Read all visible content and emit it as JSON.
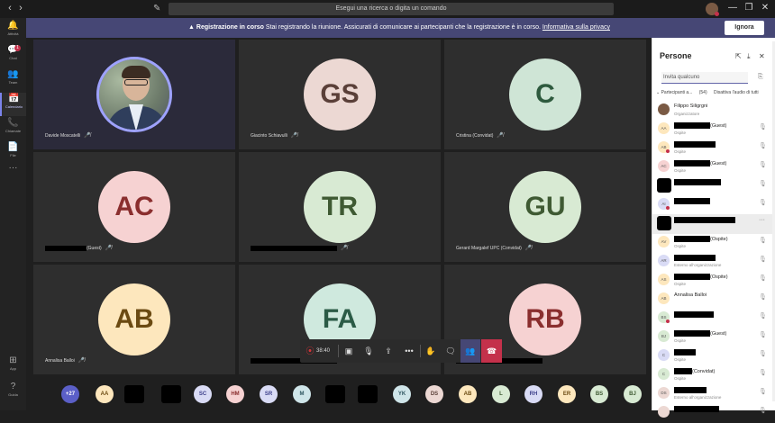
{
  "titlebar": {
    "search_text": "Esegui una ricerca o digita un comando",
    "back": "‹",
    "fwd": "›",
    "edit_icon": "✎",
    "minimize": "—",
    "maximize": "❐",
    "close": "✕"
  },
  "rail": [
    {
      "label": "Attività",
      "icon": "🔔"
    },
    {
      "label": "Chat",
      "icon": "💬",
      "badge": "1"
    },
    {
      "label": "Team",
      "icon": "👥"
    },
    {
      "label": "Calendario",
      "icon": "📅",
      "active": true
    },
    {
      "label": "Chiamate",
      "icon": "📞"
    },
    {
      "label": "File",
      "icon": "📄"
    },
    {
      "label": "",
      "icon": "···"
    },
    {
      "label": "App",
      "icon": "⊞"
    },
    {
      "label": "Guida",
      "icon": "?"
    }
  ],
  "banner": {
    "bold": "Registrazione in corso",
    "text": " Stai registrando la riunione. Assicurati di comunicare ai partecipanti che la registrazione è in corso. ",
    "link": "Informativa sulla privacy",
    "ignore": "Ignora",
    "icon": "▲"
  },
  "tiles": [
    {
      "name": "Davide Moscatelli",
      "initials": "",
      "photo": true
    },
    {
      "name": "Giacinto Schiavulli",
      "initials": "GS",
      "bg": "#ecd8d3",
      "fg": "#5a3f38"
    },
    {
      "name": "Cristina (Convidat)",
      "initials": "C",
      "bg": "#cfe5d6",
      "fg": "#2e5a3e"
    },
    {
      "name": "(Guest)",
      "initials": "AC",
      "bg": "#f6d2d2",
      "fg": "#8a2e2e",
      "redacted": true
    },
    {
      "name": "",
      "initials": "TR",
      "bg": "#d8ead3",
      "fg": "#3f5a33",
      "redacted": true
    },
    {
      "name": "Gerard Margalef UPC (Convidat)",
      "initials": "GU",
      "bg": "#d8ead3",
      "fg": "#3f5a33"
    },
    {
      "name": "Annalisa Balloi",
      "initials": "AB",
      "bg": "#fde7bd",
      "fg": "#6b4a12"
    },
    {
      "name": "",
      "initials": "FA",
      "bg": "#cfe9de",
      "fg": "#2b5b46",
      "redacted": true
    },
    {
      "name": "",
      "initials": "RB",
      "bg": "#f6d2d2",
      "fg": "#8a2e2e",
      "redacted": true
    }
  ],
  "controls": {
    "timer": "38:40",
    "rec": "⦿",
    "camera": "▣",
    "mic": "🎙",
    "share": "⇪",
    "more": "•••",
    "hand": "✋",
    "chat": "🗨",
    "people": "👥",
    "hangup": "☎"
  },
  "strip": [
    {
      "t": "+27",
      "bg": "#5b5fc7",
      "fg": "#fff"
    },
    {
      "t": "AA",
      "bg": "#fde7bd",
      "fg": "#6b4a12"
    },
    {
      "t": "",
      "black": true
    },
    {
      "t": "",
      "black": true
    },
    {
      "t": "SC",
      "bg": "#d9dbf5",
      "fg": "#3d3f8a"
    },
    {
      "t": "HM",
      "bg": "#f6d2d2",
      "fg": "#8a2e2e"
    },
    {
      "t": "SR",
      "bg": "#d9dbf5",
      "fg": "#3d3f8a"
    },
    {
      "t": "M",
      "bg": "#cfe5e9",
      "fg": "#2e5560"
    },
    {
      "t": "",
      "black": true
    },
    {
      "t": "",
      "black": true
    },
    {
      "t": "YK",
      "bg": "#cfe5e9",
      "fg": "#2e5560"
    },
    {
      "t": "DS",
      "bg": "#ecd8d3",
      "fg": "#5a3f38"
    },
    {
      "t": "AB",
      "bg": "#fde7bd",
      "fg": "#6b4a12"
    },
    {
      "t": "L",
      "bg": "#d8ead3",
      "fg": "#3f5a33"
    },
    {
      "t": "RH",
      "bg": "#d9dbf5",
      "fg": "#3d3f8a"
    },
    {
      "t": "ER",
      "bg": "#fde7bd",
      "fg": "#6b4a12"
    },
    {
      "t": "BS",
      "bg": "#d8ead3",
      "fg": "#3f5a33"
    },
    {
      "t": "BJ",
      "bg": "#d8ead3",
      "fg": "#3f5a33"
    }
  ],
  "panel": {
    "title": "Persone",
    "invite_placeholder": "Invita qualcuno",
    "section_label": "Partecipanti a...",
    "count": "(54)",
    "mute_all": "Disattiva l'audio di tutti",
    "rows": [
      {
        "name": "Filippo Siligrgni",
        "sub": "Organizzatore",
        "initials": "",
        "photo": true,
        "bg": "#7a5a44"
      },
      {
        "name": "(Guest)",
        "sub": "Ospite",
        "initials": "AA",
        "bg": "#fde7bd",
        "redact_w": 40
      },
      {
        "name": "",
        "sub": "Ospite",
        "initials": "AB",
        "bg": "#fde7bd",
        "dot": true,
        "redact_w": 46
      },
      {
        "name": "(Guest)",
        "sub": "Ospite",
        "initials": "AC",
        "bg": "#f6d2d2",
        "redact_w": 40
      },
      {
        "name": "",
        "sub": "",
        "initials": "",
        "black": true,
        "redact_w": 52
      },
      {
        "name": "",
        "sub": "",
        "initials": "AI",
        "bg": "#d9dbf5",
        "dot": true,
        "redact_w": 40
      },
      {
        "name": "",
        "sub": "",
        "initials": "",
        "black": true,
        "redact_w": 68,
        "highlight": true
      },
      {
        "name": "(Ospite)",
        "sub": "Ospite",
        "initials": "AV",
        "bg": "#fde7bd",
        "redact_w": 40
      },
      {
        "name": "",
        "sub": "Esterno all'organizzazione",
        "initials": "AR",
        "bg": "#d9dbf5",
        "redact_w": 46
      },
      {
        "name": "(Ospite)",
        "sub": "Ospite",
        "initials": "AS",
        "bg": "#fde7bd",
        "redact_w": 40
      },
      {
        "name": "Annalisa Balloi",
        "sub": "",
        "initials": "AB",
        "bg": "#fde7bd"
      },
      {
        "name": "",
        "sub": "",
        "initials": "BS",
        "bg": "#d8ead3",
        "dot": true,
        "redact_w": 44
      },
      {
        "name": "(Guest)",
        "sub": "Ospite",
        "initials": "BJ",
        "bg": "#d8ead3",
        "redact_w": 40
      },
      {
        "name": "",
        "sub": "Ospite",
        "initials": "C",
        "bg": "#d9dbf5",
        "redact_w": 24
      },
      {
        "name": "(Convidat)",
        "sub": "Ospite",
        "initials": "C",
        "bg": "#d8ead3",
        "redact_w": 20
      },
      {
        "name": "",
        "sub": "Esterno all'organizzazione",
        "initials": "DS",
        "bg": "#ecd8d3",
        "redact_w": 36
      },
      {
        "name": "",
        "sub": "",
        "initials": "",
        "bg": "#ecd8d3",
        "redact_w": 50
      }
    ],
    "icons": {
      "close": "✕",
      "download": "⤓",
      "popout": "⇱",
      "mic_off": "🎙"
    }
  }
}
